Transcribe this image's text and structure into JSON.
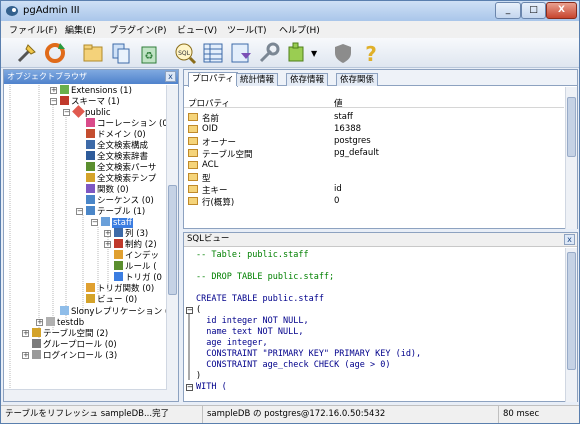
{
  "window": {
    "title": "pgAdmin III",
    "minimize": "_",
    "maximize": "□",
    "close": "X"
  },
  "menu": [
    "ファイル(F)",
    "編集(E)",
    "プラグイン(P)",
    "ビュー(V)",
    "ツール(T)",
    "ヘルプ(H)"
  ],
  "toolbar": {
    "icons": [
      "connect-icon",
      "refresh-icon",
      "folder-icon",
      "copy-icon",
      "recycle-icon",
      "sql-icon",
      "table-view-icon",
      "filter-icon",
      "wrench-icon",
      "plugin-icon",
      "chevron-down-icon",
      "shield-icon",
      "help-icon"
    ],
    "sql_label": "SQL"
  },
  "browser": {
    "title": "オブジェクトブラウザ",
    "close": "x",
    "items": [
      {
        "label": "Extensions (1)"
      },
      {
        "label": "スキーマ (1)"
      },
      {
        "label": "public"
      },
      {
        "label": "コーレーション (0"
      },
      {
        "label": "ドメイン (0)"
      },
      {
        "label": "全文検索構成"
      },
      {
        "label": "全文検索辞書"
      },
      {
        "label": "全文検索パーサ"
      },
      {
        "label": "全文検索テンプ"
      },
      {
        "label": "関数 (0)"
      },
      {
        "label": "シーケンス (0)"
      },
      {
        "label": "テーブル (1)"
      },
      {
        "label": "staff"
      },
      {
        "label": "列 (3)"
      },
      {
        "label": "制約 (2)"
      },
      {
        "label": "インデッ"
      },
      {
        "label": "ルール ("
      },
      {
        "label": "トリガ (0"
      },
      {
        "label": "トリガ関数 (0)"
      },
      {
        "label": "ビュー (0)"
      },
      {
        "label": "Slonyレプリケーション (0"
      },
      {
        "label": "testdb"
      },
      {
        "label": "テーブル空間 (2)"
      },
      {
        "label": "グループロール (0)"
      },
      {
        "label": "ログインロール (3)"
      }
    ]
  },
  "properties": {
    "tabs": [
      "プロパティ",
      "統計情報",
      "依存情報",
      "依存関係"
    ],
    "col_property": "プロパティ",
    "col_value": "値",
    "rows": [
      {
        "name": "名前",
        "value": "staff"
      },
      {
        "name": "OID",
        "value": "16388"
      },
      {
        "name": "オーナー",
        "value": "postgres"
      },
      {
        "name": "テーブル空間",
        "value": "pg_default"
      },
      {
        "name": "ACL",
        "value": ""
      },
      {
        "name": "型",
        "value": ""
      },
      {
        "name": "主キー",
        "value": "id"
      },
      {
        "name": "行(概算)",
        "value": "0"
      }
    ]
  },
  "sql": {
    "title": "SQLビュー",
    "close": "x",
    "lines": [
      "-- Table: public.staff",
      "",
      "-- DROP TABLE public.staff;",
      "",
      "CREATE TABLE public.staff",
      "(",
      "  id integer NOT NULL,",
      "  name text NOT NULL,",
      "  age integer,",
      "  CONSTRAINT \"PRIMARY KEY\" PRIMARY KEY (id),",
      "  CONSTRAINT age_check CHECK (age > 0)",
      ")",
      "WITH ("
    ]
  },
  "status": {
    "left": "テーブルをリフレッシュ sampleDB...完了",
    "middle": "sampleDB の postgres@172.16.0.50:5432",
    "right": "80 msec"
  }
}
